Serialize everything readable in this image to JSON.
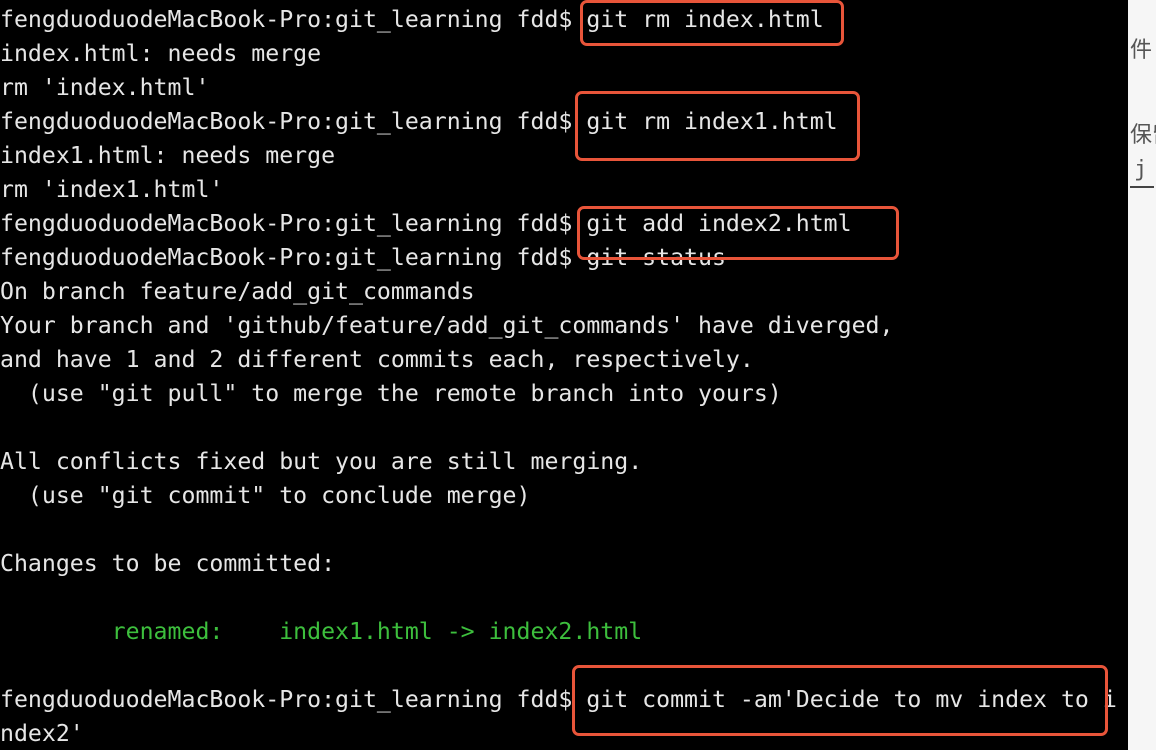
{
  "terminal": {
    "lines": [
      {
        "prompt": "fengduoduodeMacBook-Pro:git_learning fdd$",
        "command": " git rm index.html"
      },
      {
        "text": "index.html: needs merge"
      },
      {
        "text": "rm 'index.html'"
      },
      {
        "prompt": "fengduoduodeMacBook-Pro:git_learning fdd$",
        "command": " git rm index1.html"
      },
      {
        "text": "index1.html: needs merge"
      },
      {
        "text": "rm 'index1.html'"
      },
      {
        "prompt": "fengduoduodeMacBook-Pro:git_learning fdd$",
        "command": " git add index2.html"
      },
      {
        "prompt": "fengduoduodeMacBook-Pro:git_learning fdd$",
        "command": " git status"
      },
      {
        "text": "On branch feature/add_git_commands"
      },
      {
        "text": "Your branch and 'github/feature/add_git_commands' have diverged,"
      },
      {
        "text": "and have 1 and 2 different commits each, respectively."
      },
      {
        "text": "  (use \"git pull\" to merge the remote branch into yours)"
      },
      {
        "text": ""
      },
      {
        "text": "All conflicts fixed but you are still merging."
      },
      {
        "text": "  (use \"git commit\" to conclude merge)"
      },
      {
        "text": ""
      },
      {
        "text": "Changes to be committed:"
      },
      {
        "text": ""
      },
      {
        "text": "        renamed:    index1.html -> index2.html"
      },
      {
        "text": ""
      },
      {
        "prompt": "fengduoduodeMacBook-Pro:git_learning fdd$",
        "command": " git commit -am'Decide to mv index to i"
      },
      {
        "text": "ndex2'"
      }
    ],
    "highlight_color": "#e8553a",
    "renamed_color": "#3dbf3d"
  },
  "side_panel": {
    "glyphs": [
      "件",
      "保留",
      "j"
    ]
  }
}
